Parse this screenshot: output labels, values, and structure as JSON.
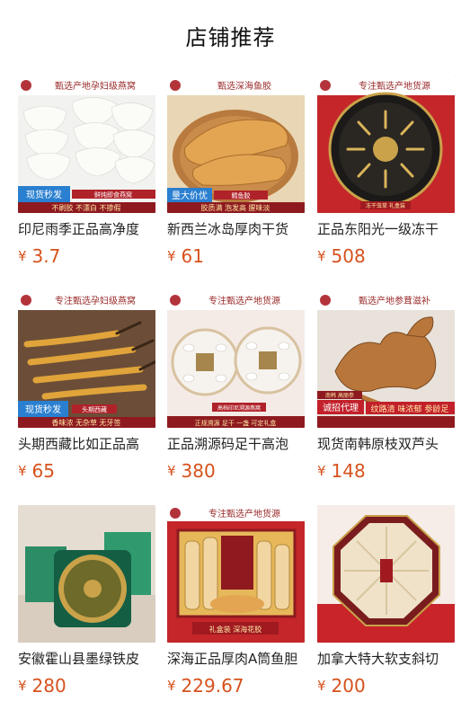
{
  "header": {
    "title": "店铺推荐"
  },
  "currency": "¥",
  "products": [
    {
      "title": "印尼雨季正品高净度",
      "price": "3.7",
      "banner": "甄选产地孕妇级燕窝",
      "badge": "现货秒发",
      "badge2": "鲜炖即食燕窝",
      "tags": "不刷胶 不漂白 不掺假"
    },
    {
      "title": "新西兰冰岛厚肉干货",
      "price": "61",
      "banner": "甄选深海鱼胶",
      "badge": "量大价优",
      "badge2": "鳕鱼胶",
      "tags": "胶质满 泡发高 腥味淡"
    },
    {
      "title": "正品东阳光一级冻干",
      "price": "508",
      "banner": "专注甄选产地货源",
      "badge": "",
      "badge2": "冻干虫草 礼盒装",
      "tags": ""
    },
    {
      "title": "头期西藏比如正品高",
      "price": "65",
      "banner": "专注甄选孕妇级燕窝",
      "badge": "现货秒发",
      "badge2": "头期西藏",
      "tags": "香味浓 无杂草 无牙签"
    },
    {
      "title": "正品溯源码足干高泡",
      "price": "380",
      "banner": "专注甄选产地货源",
      "badge": "",
      "badge2": "高档印尼溯源燕窝",
      "tags": "正规溯源 足干 一盏 可定礼盒"
    },
    {
      "title": "现货南韩原枝双芦头",
      "price": "148",
      "banner": "甄选产地参茸滋补",
      "badge": "诚招代理",
      "badge2": "南韩 高丽参",
      "tags": "纹路清 味浓郁 参龄足"
    },
    {
      "title": "安徽霍山县墨绿铁皮",
      "price": "280",
      "banner": "",
      "badge": "",
      "badge2": "",
      "tags": ""
    },
    {
      "title": "深海正品厚肉A筒鱼胆",
      "price": "229.67",
      "banner": "专注甄选产地货源",
      "badge": "",
      "badge2": "礼盒装 深海花胶",
      "tags": ""
    },
    {
      "title": "加拿大特大软支斜切",
      "price": "200",
      "banner": "",
      "badge": "",
      "badge2": "",
      "tags": ""
    }
  ],
  "colors": {
    "price": "#d6521d",
    "banner_red": "#c41e2a",
    "gold": "#e3b54a"
  },
  "icons": [
    "store-logo-icon",
    "product-image"
  ]
}
